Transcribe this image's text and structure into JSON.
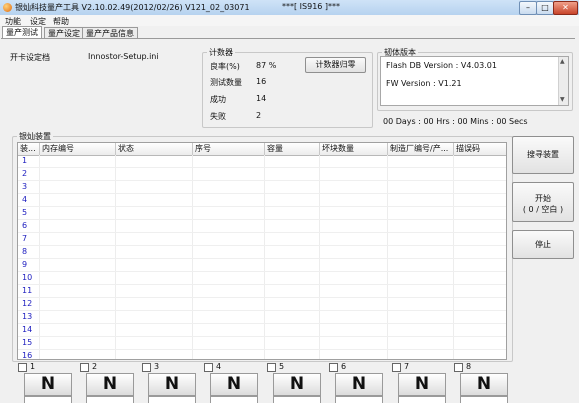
{
  "window": {
    "title": "银灿科技量产工具 V2.10.02.49(2012/02/26)    V121_02_03071",
    "title_center": "***[ IS916 ]***",
    "controls": {
      "minimize": "–",
      "maximize": "□",
      "close": "✕"
    }
  },
  "menu": [
    "功能",
    "设定",
    "帮助"
  ],
  "tabs": [
    "量产测试",
    "量产设定",
    "量产产品信息"
  ],
  "open_card": {
    "label": "开卡设定档",
    "value": "Innostor-Setup.ini"
  },
  "counter": {
    "title": "计数器",
    "rows": [
      {
        "label": "良率(%)",
        "value": "87 %"
      },
      {
        "label": "测试数量",
        "value": "16"
      },
      {
        "label": "成功",
        "value": "14"
      },
      {
        "label": "失败",
        "value": "2"
      }
    ],
    "reset_button": "计数器归零"
  },
  "firmware": {
    "title": "韧体版本",
    "flash_db": "Flash DB Version :  V4.03.01",
    "fw": "FW Version :   V1.21"
  },
  "elapsed": "00 Days : 00 Hrs : 00 Mins : 00 Secs",
  "device_group": "银灿装置",
  "columns": [
    "装...",
    "内存编号",
    "状态",
    "序号",
    "容量",
    "坏块数量",
    "制造厂编号/产...",
    "描误码"
  ],
  "rows": [
    "1",
    "2",
    "3",
    "4",
    "5",
    "6",
    "7",
    "8",
    "9",
    "10",
    "11",
    "12",
    "13",
    "14",
    "15",
    "16"
  ],
  "buttons": {
    "search": "搜寻装置",
    "start_line1": "开始",
    "start_line2": "( 0 / 空白 )",
    "stop": "停止"
  },
  "ports": [
    {
      "number": "1",
      "status": "N"
    },
    {
      "number": "2",
      "status": "N"
    },
    {
      "number": "3",
      "status": "N"
    },
    {
      "number": "4",
      "status": "N"
    },
    {
      "number": "5",
      "status": "N"
    },
    {
      "number": "6",
      "status": "N"
    },
    {
      "number": "7",
      "status": "N"
    },
    {
      "number": "8",
      "status": "N"
    }
  ]
}
